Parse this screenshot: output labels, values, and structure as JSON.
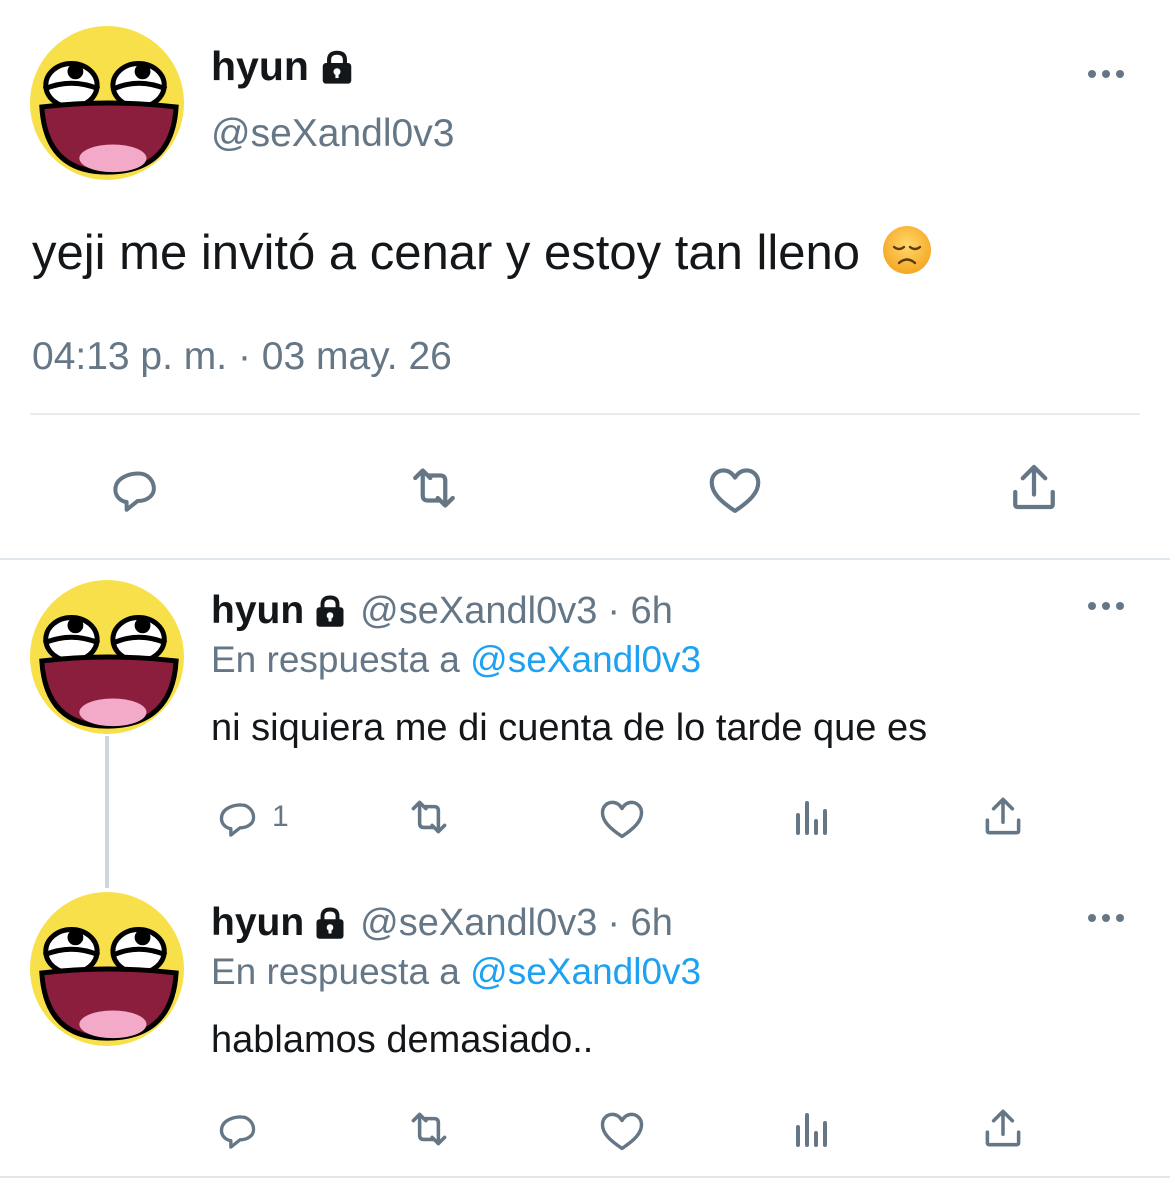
{
  "main_tweet": {
    "name": "hyun",
    "handle": "@seXandl0v3",
    "text": "yeji me invitó a cenar y estoy tan lleno",
    "emoji": "😞",
    "timestamp": "04:13 p. m. · 03 may. 26",
    "icons": [
      "reply-icon",
      "retweet-icon",
      "like-icon",
      "share-icon"
    ]
  },
  "replies": [
    {
      "name": "hyun",
      "handle": "@seXandl0v3",
      "time": "· 6h",
      "in_reply_prefix": "En respuesta a",
      "in_reply_mention": "@seXandl0v3",
      "text": "ni siquiera me di cuenta de lo tarde que es",
      "reply_count": "1"
    },
    {
      "name": "hyun",
      "handle": "@seXandl0v3",
      "time": "· 6h",
      "in_reply_prefix": "En respuesta a",
      "in_reply_mention": "@seXandl0v3",
      "text": "hablamos demasiado..",
      "reply_count": ""
    }
  ],
  "colors": {
    "text": "#14171a",
    "secondary": "#657786",
    "link": "#1da1f2",
    "divider": "#e6ecf0",
    "avatar_yellow": "#f8e04b"
  }
}
